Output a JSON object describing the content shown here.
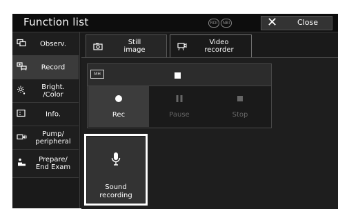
{
  "header": {
    "title": "Function list",
    "modes": [
      "RDI",
      "NBI"
    ],
    "close_label": "Close"
  },
  "sidebar": {
    "items": [
      {
        "label": "Observ.",
        "icon": "observation-icon",
        "active": false
      },
      {
        "label": "Record",
        "icon": "record-icon",
        "active": true
      },
      {
        "label": "Bright.\n/Color",
        "icon": "brightness-icon",
        "active": false
      },
      {
        "label": "Info.",
        "icon": "info-icon",
        "active": false
      },
      {
        "label": "Pump/\nperipheral",
        "icon": "pump-icon",
        "active": false
      },
      {
        "label": "Prepare/\nEnd Exam",
        "icon": "prepare-icon",
        "active": false
      }
    ]
  },
  "tabs": [
    {
      "label": "Still\nimage",
      "icon": "camera-icon",
      "active": false
    },
    {
      "label": "Video\nrecorder",
      "icon": "video-recorder-icon",
      "active": true
    }
  ],
  "recorder": {
    "media_label": "MH",
    "controls": [
      {
        "label": "Rec",
        "icon": "record-dot-icon",
        "enabled": true
      },
      {
        "label": "Pause",
        "icon": "pause-icon",
        "enabled": false
      },
      {
        "label": "Stop",
        "icon": "stop-icon",
        "enabled": false
      }
    ]
  },
  "sound_recording": {
    "label": "Sound\nrecording",
    "icon": "microphone-icon"
  }
}
